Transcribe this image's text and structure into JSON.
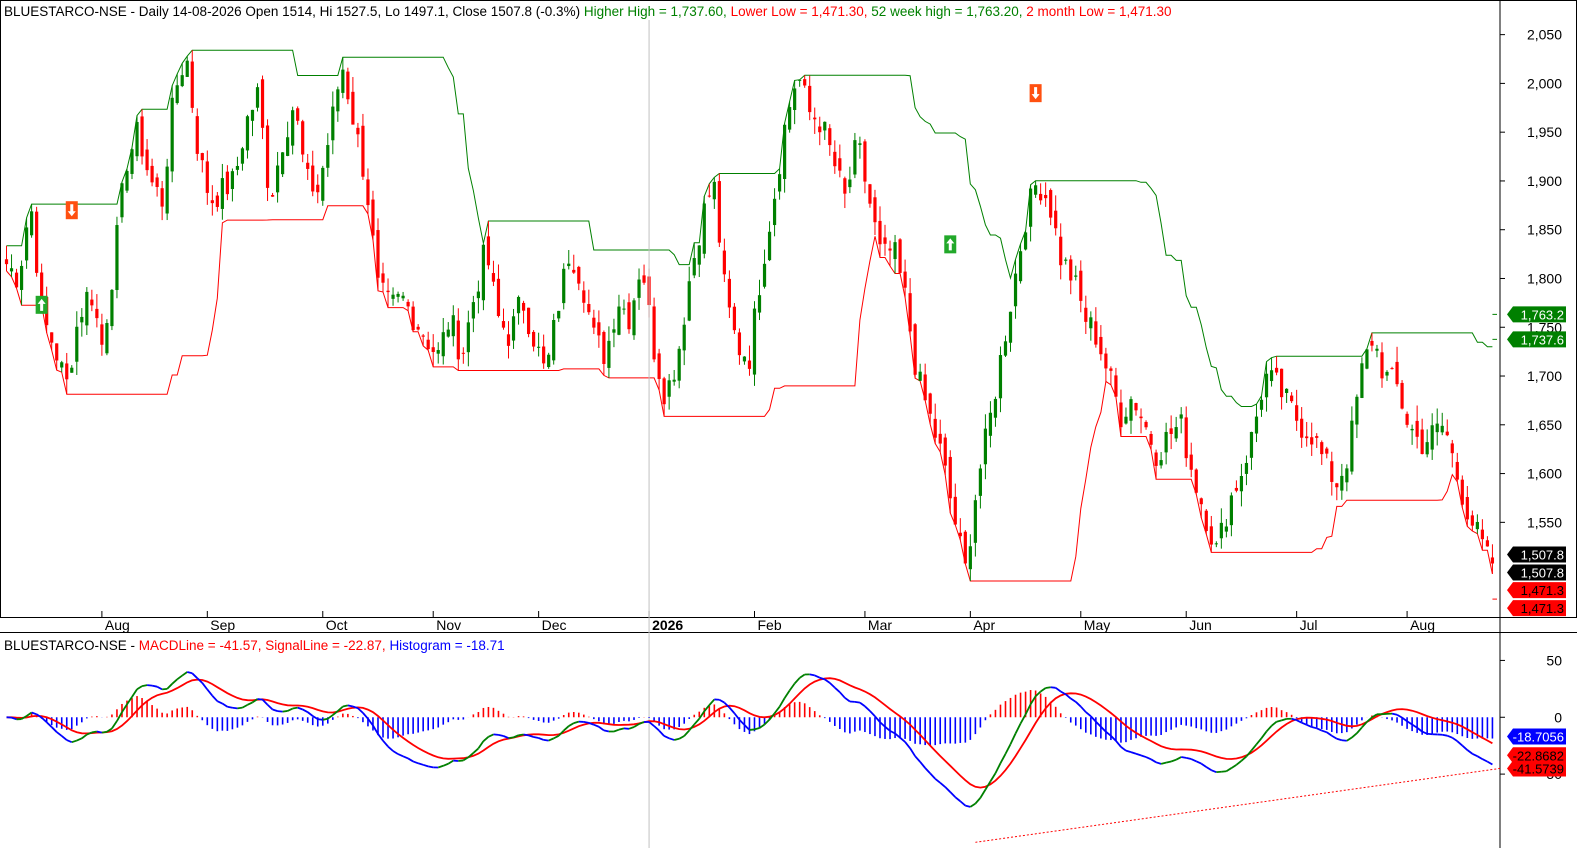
{
  "header": {
    "symbol": "BLUESTARCO-NSE",
    "dash": " - ",
    "summary": "Daily 14-08-2026 Open 1514, Hi 1527.5, Lo 1497.1, Close 1507.8 (-0.3%) ",
    "higher_high": "Higher High = 1,737.60, ",
    "lower_low": "Lower Low = 1,471.30, ",
    "wk52_high": "52 week high = 1,763.20, ",
    "month2_low": "2 month Low = 1,471.30"
  },
  "macd_header": {
    "symbol": "BLUESTARCO-NSE",
    "dash": " - ",
    "macd": "MACDLine = -41.57, ",
    "signal": "SignalLine = -22.87, ",
    "hist": "Histogram = -18.71"
  },
  "colors": {
    "up": "#008000",
    "down": "#ff0000",
    "upper_channel": "#008000",
    "lower_channel": "#ff0000",
    "macd_up": "#008000",
    "macd_down": "#0000ff",
    "signal": "#ff0000",
    "hist_pos": "#ff0000",
    "hist_neg": "#0000ff"
  },
  "chart_data": [
    {
      "type": "candlestick",
      "title": "BLUESTARCO-NSE - Daily",
      "ylim": [
        1455,
        2065
      ],
      "y_ticks": [
        "2,050",
        "2,000",
        "1,950",
        "1,900",
        "1,850",
        "1,800",
        "1,750",
        "1,700",
        "1,650",
        "1,600",
        "1,550"
      ],
      "y_tick_values": [
        2050,
        2000,
        1950,
        1900,
        1850,
        1800,
        1750,
        1700,
        1650,
        1600,
        1550
      ],
      "x_labels": [
        "Aug",
        "Sep",
        "Oct",
        "Nov",
        "Dec",
        "2026",
        "Feb",
        "Mar",
        "Apr",
        "May",
        "Jun",
        "Jul",
        "Aug"
      ],
      "x_label_bar_index": [
        19,
        40,
        63,
        85,
        106,
        128,
        149,
        171,
        192,
        214,
        235,
        257,
        279
      ],
      "close_path": [
        1815,
        1800,
        1880,
        1760,
        1730,
        1690,
        1760,
        1790,
        1730,
        1820,
        1920,
        1950,
        1900,
        1880,
        1990,
        2030,
        1930,
        1880,
        1890,
        1900,
        1960,
        1990,
        1880,
        1940,
        1980,
        1900,
        1890,
        1950,
        2020,
        1960,
        1900,
        1790,
        1770,
        1780,
        1760,
        1740,
        1720,
        1760,
        1720,
        1780,
        1830,
        1760,
        1740,
        1780,
        1740,
        1700,
        1770,
        1830,
        1800,
        1740,
        1720,
        1780,
        1760,
        1820,
        1730,
        1680,
        1720,
        1800,
        1860,
        1900,
        1780,
        1730,
        1720,
        1810,
        1880,
        1960,
        2010,
        1970,
        1960,
        1920,
        1880,
        1940,
        1880,
        1820,
        1830,
        1780,
        1700,
        1660,
        1620,
        1560,
        1500,
        1590,
        1650,
        1720,
        1790,
        1860,
        1900,
        1880,
        1820,
        1800,
        1760,
        1740,
        1700,
        1660,
        1680,
        1650,
        1620,
        1640,
        1650,
        1600,
        1560,
        1520,
        1570,
        1600,
        1640,
        1700,
        1690,
        1670,
        1650,
        1640,
        1610,
        1590,
        1620,
        1700,
        1740,
        1700,
        1690,
        1650,
        1630,
        1640,
        1650,
        1600,
        1560,
        1530,
        1500
      ],
      "close": 1507.8,
      "open": 1514,
      "high": 1527.5,
      "low": 1497.1,
      "higher_high": 1737.6,
      "lower_low": 1471.3,
      "week52_high": 1763.2,
      "month2_low": 1471.3,
      "price_tags": [
        {
          "label": "1,763.2",
          "value": 1763.2,
          "bg": "#008000",
          "fg": "#ffffff"
        },
        {
          "label": "1,737.6",
          "value": 1737.6,
          "bg": "#008000",
          "fg": "#ffffff"
        },
        {
          "label": "1,507.8",
          "value": 1507.8,
          "bg": "#000000",
          "fg": "#ffffff"
        },
        {
          "label": "1,507.8",
          "value": 1507.8,
          "bg": "#000000",
          "fg": "#ffffff"
        },
        {
          "label": "1,471.3",
          "value": 1471.3,
          "bg": "#ff0000",
          "fg": "#000000"
        },
        {
          "label": "1,471.3",
          "value": 1471.3,
          "bg": "#ff0000",
          "fg": "#000000"
        }
      ],
      "signals": [
        {
          "kind": "buy",
          "bar": 7,
          "value": 1773
        },
        {
          "kind": "sell",
          "bar": 13,
          "value": 1870
        },
        {
          "kind": "buy",
          "bar": 188,
          "value": 1835
        },
        {
          "kind": "sell",
          "bar": 205,
          "value": 1990
        }
      ]
    },
    {
      "type": "line",
      "title": "MACD",
      "ylim": [
        -115,
        75
      ],
      "y_ticks": [
        "50",
        "0",
        "-50"
      ],
      "y_tick_values": [
        50,
        0,
        -50
      ],
      "macd_line": -41.57,
      "signal_line": -22.87,
      "histogram": -18.71,
      "value_tags": [
        {
          "label": "-18.7056",
          "value": -18.7056,
          "bg": "#0000ff",
          "fg": "#ffffff"
        },
        {
          "label": "-22.8682",
          "value": -22.8682,
          "bg": "#ff0000",
          "fg": "#000000"
        },
        {
          "label": "-41.5739",
          "value": -41.5739,
          "bg": "#ff0000",
          "fg": "#000000"
        }
      ],
      "divergence_line": {
        "from": -110,
        "to": -45
      }
    }
  ]
}
